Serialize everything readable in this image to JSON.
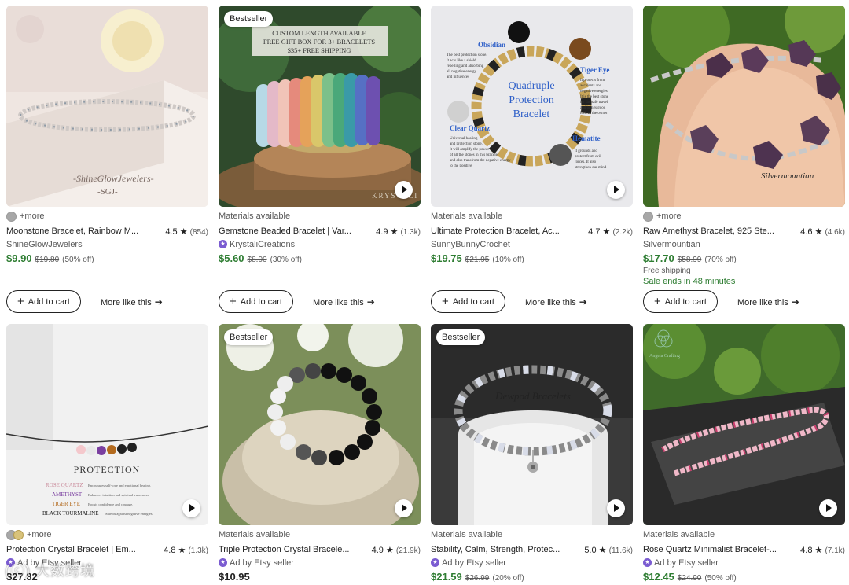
{
  "listings": [
    {
      "meta": "+more",
      "title": "Moonstone Bracelet, Rainbow M...",
      "rating": "4.5",
      "count": "(854)",
      "seller": "ShineGlowJewelers",
      "price": "$9.90",
      "orig": "$19.80",
      "off": "(50% off)",
      "image_text": [
        "-ShineGlowJewelers-",
        "-SGJ-"
      ]
    },
    {
      "badge": "Bestseller",
      "meta": "Materials available",
      "title": "Gemstone Beaded Bracelet | Var...",
      "rating": "4.9",
      "count": "(1.3k)",
      "seller": "KrystaliCreations",
      "price": "$5.60",
      "orig": "$8.00",
      "off": "(30% off)",
      "image_text": [
        "CUSTOM LENGTH AVAILABLE",
        "FREE GIFT BOX FOR 3+ BRACELETS",
        "$35+ FREE SHIPPING",
        "KRYSTALI"
      ]
    },
    {
      "meta": "Materials available",
      "title": "Ultimate Protection Bracelet, Ac...",
      "rating": "4.7",
      "count": "(2.2k)",
      "seller": "SunnyBunnyCrochet",
      "price": "$19.75",
      "orig": "$21.95",
      "off": "(10% off)",
      "image_text": {
        "center": [
          "Quadruple",
          "Protection",
          "Bracelet"
        ],
        "obsidian": "Obsidian",
        "obsidian_desc": [
          "The best protection stone.",
          "It acts like a shield",
          "repelling and absorbing",
          "all negative energy",
          "and influences"
        ],
        "tiger": "Tiger Eye",
        "tiger_desc": [
          "It protects from",
          "accidents and",
          "negative energies",
          "It is the best stone",
          "for the safe travel",
          "and brings good",
          "luck to the owner"
        ],
        "clear": "Clear Quartz",
        "clear_desc": [
          "Universal healing",
          "and protection stone.",
          "It will amplify the power",
          "of all the stones in this bracelet",
          "and also transfrom the negative energy",
          "to the positive"
        ],
        "hematite": "Hematite",
        "hematite_desc": [
          "It grounds and",
          "protect from evil",
          "forces. It also",
          "strengthen our mind"
        ]
      }
    },
    {
      "meta": "+more",
      "title": "Raw Amethyst Bracelet, 925 Ste...",
      "rating": "4.6",
      "count": "(4.6k)",
      "seller": "Silvermountian",
      "price": "$17.70",
      "orig": "$58.99",
      "off": "(70% off)",
      "extra": "Free shipping",
      "sale": "Sale ends in 48 minutes",
      "image_text": [
        "Silvermountian"
      ]
    },
    {
      "meta": "+more",
      "title": "Protection Crystal Bracelet | Em...",
      "rating": "4.8",
      "count": "(1.3k)",
      "seller": "Ad by Etsy seller",
      "price": "$27.82",
      "image_text": {
        "heading": "PROTECTION",
        "rose": "ROSE QUARTZ",
        "rose_desc": "Encourages self-love and emotional healing.",
        "amethyst": "AMETHYST",
        "amethyst_desc": "Enhances intuition and spiritual awareness.",
        "tiger": "TIGER EYE",
        "tiger_desc": "Boosts confidence and courage.",
        "black": "BLACK TOURMALINE",
        "black_desc": "Shields against negative energies."
      }
    },
    {
      "badge": "Bestseller",
      "meta": "Materials available",
      "title": "Triple Protection Crystal Bracele...",
      "rating": "4.9",
      "count": "(21.9k)",
      "seller": "Ad by Etsy seller",
      "price": "$10.95"
    },
    {
      "badge": "Bestseller",
      "meta": "Materials available",
      "title": "Stability, Calm, Strength, Protec...",
      "rating": "5.0",
      "count": "(11.6k)",
      "seller": "Ad by Etsy seller",
      "price": "$21.59",
      "orig": "$26.99",
      "off": "(20% off)",
      "image_text": [
        "Dewpod Bracelets"
      ]
    },
    {
      "meta": "Materials available",
      "title": "Rose Quartz Minimalist Bracelet-...",
      "rating": "4.8",
      "count": "(7.1k)",
      "seller": "Ad by Etsy seller",
      "price": "$12.45",
      "orig": "$24.90",
      "off": "(50% off)",
      "image_text": [
        "Angeia Crafting"
      ]
    }
  ],
  "ui": {
    "add_to_cart": "Add to cart",
    "more_like_this": "More like this",
    "watermark": "(ⓒ) 大数跨境"
  },
  "colors": {
    "sale_green": "#2e7d32",
    "ad_star": "#7b5cd1",
    "text": "#222222",
    "muted": "#595959"
  }
}
